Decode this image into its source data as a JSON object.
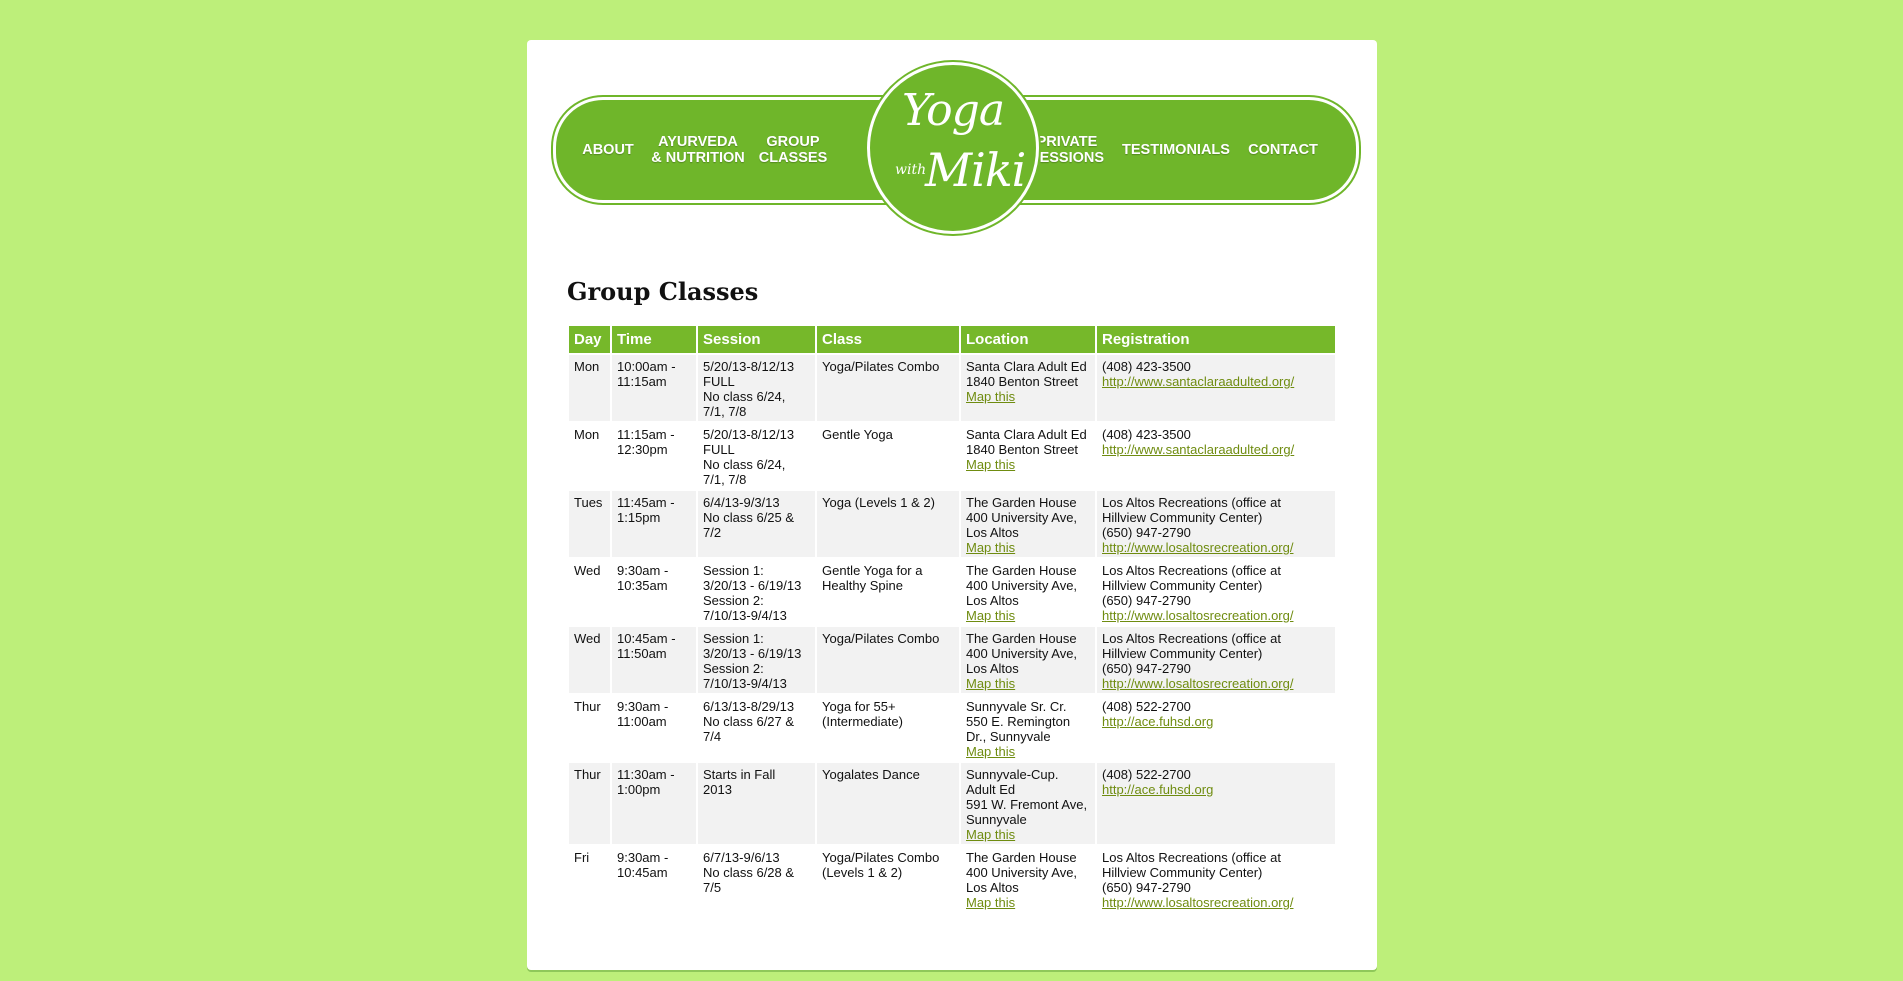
{
  "nav": {
    "left": [
      "ABOUT",
      "AYURVEDA\n& NUTRITION",
      "GROUP\nCLASSES"
    ],
    "right": [
      "PRIVATE\nSESSIONS",
      "TESTIMONIALS",
      "CONTACT"
    ]
  },
  "logo": {
    "top": "Yoga",
    "small": "with",
    "bottom": "Miki"
  },
  "page_title": "Group Classes",
  "table": {
    "headers": [
      "Day",
      "Time",
      "Session",
      "Class",
      "Location",
      "Registration"
    ],
    "rows": [
      {
        "day": "Mon",
        "time": [
          "10:00am -",
          "11:15am"
        ],
        "session": [
          "5/20/13-8/12/13",
          "FULL",
          "No class 6/24,",
          "7/1, 7/8"
        ],
        "class": [
          "Yoga/Pilates Combo"
        ],
        "location": [
          "Santa Clara Adult Ed",
          "1840 Benton Street"
        ],
        "map": "Map this",
        "registration": [
          "(408) 423-3500"
        ],
        "link": "http://www.santaclaraadulted.org/"
      },
      {
        "day": "Mon",
        "time": [
          "11:15am -",
          "12:30pm"
        ],
        "session": [
          "5/20/13-8/12/13",
          "FULL",
          "No class 6/24,",
          "7/1, 7/8"
        ],
        "class": [
          "Gentle Yoga"
        ],
        "location": [
          "Santa Clara Adult Ed",
          "1840 Benton Street"
        ],
        "map": "Map this",
        "registration": [
          "(408) 423-3500"
        ],
        "link": "http://www.santaclaraadulted.org/"
      },
      {
        "day": "Tues",
        "time": [
          "11:45am -",
          "1:15pm"
        ],
        "session": [
          "6/4/13-9/3/13",
          "No class 6/25 &",
          "7/2"
        ],
        "class": [
          "Yoga (Levels 1 & 2)"
        ],
        "location": [
          "The Garden House",
          "400 University Ave,",
          "Los Altos"
        ],
        "map": "Map this",
        "registration": [
          "Los Altos Recreations (office at",
          "Hillview Community Center)",
          "(650) 947-2790"
        ],
        "link": "http://www.losaltosrecreation.org/"
      },
      {
        "day": "Wed",
        "time": [
          "9:30am -",
          "10:35am"
        ],
        "session": [
          "Session 1:",
          "3/20/13 - 6/19/13",
          "Session 2:",
          "7/10/13-9/4/13"
        ],
        "class": [
          "Gentle Yoga for a",
          "Healthy Spine"
        ],
        "location": [
          "The Garden House",
          "400 University Ave,",
          "Los Altos"
        ],
        "map": "Map this",
        "registration": [
          "Los Altos Recreations (office at",
          "Hillview Community Center)",
          "(650) 947-2790"
        ],
        "link": "http://www.losaltosrecreation.org/"
      },
      {
        "day": "Wed",
        "time": [
          "10:45am -",
          "11:50am"
        ],
        "session": [
          "Session 1:",
          "3/20/13 - 6/19/13",
          "Session 2:",
          "7/10/13-9/4/13"
        ],
        "class": [
          "Yoga/Pilates Combo"
        ],
        "location": [
          "The Garden House",
          "400 University Ave,",
          "Los Altos"
        ],
        "map": "Map this",
        "registration": [
          "Los Altos Recreations (office at",
          "Hillview Community Center)",
          "(650) 947-2790"
        ],
        "link": "http://www.losaltosrecreation.org/"
      },
      {
        "day": "Thur",
        "time": [
          "9:30am -",
          "11:00am"
        ],
        "session": [
          "6/13/13-8/29/13",
          "No class 6/27 &",
          "7/4"
        ],
        "class": [
          "Yoga for 55+",
          "(Intermediate)"
        ],
        "location": [
          "Sunnyvale Sr. Cr.",
          "550 E. Remington",
          "Dr., Sunnyvale"
        ],
        "map": "Map this",
        "registration": [
          "(408) 522-2700"
        ],
        "link": "http://ace.fuhsd.org"
      },
      {
        "day": "Thur",
        "time": [
          "11:30am -",
          "1:00pm"
        ],
        "session": [
          "Starts in Fall",
          "2013"
        ],
        "class": [
          "Yogalates Dance"
        ],
        "location": [
          "Sunnyvale-Cup.",
          "Adult Ed",
          "591 W. Fremont Ave,",
          "Sunnyvale"
        ],
        "map": "Map this",
        "registration": [
          "(408) 522-2700"
        ],
        "link": "http://ace.fuhsd.org"
      },
      {
        "day": "Fri",
        "time": [
          "9:30am -",
          "10:45am"
        ],
        "session": [
          "6/7/13-9/6/13",
          "No class 6/28 &",
          "7/5"
        ],
        "class": [
          "Yoga/Pilates Combo",
          "(Levels 1 & 2)"
        ],
        "location": [
          "The Garden House",
          "400 University Ave,",
          "Los Altos"
        ],
        "map": "Map this",
        "registration": [
          "Los Altos Recreations (office at",
          "Hillview Community Center)",
          "(650) 947-2790"
        ],
        "link": "http://www.losaltosrecreation.org/"
      }
    ]
  },
  "colors": {
    "background": "#bdef7a",
    "accent": "#76b82a",
    "link": "#6f8c10",
    "row_alt": "#f2f2f2"
  }
}
